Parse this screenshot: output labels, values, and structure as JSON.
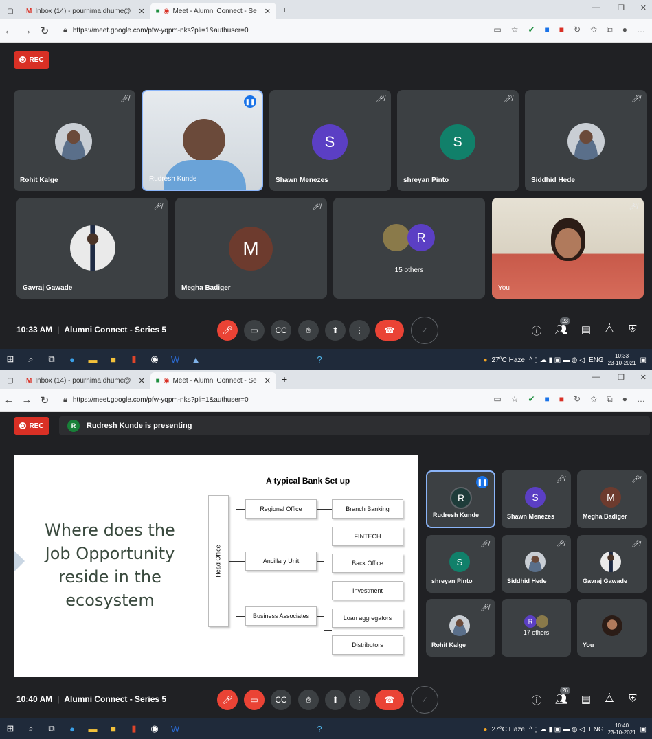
{
  "browser": {
    "tabs": [
      {
        "label": "Inbox (14) - pournima.dhume@",
        "icon": "gmail-icon"
      },
      {
        "label": "Meet - Alumni Connect - Se",
        "icon": "meet-icon"
      }
    ],
    "new_tab": "+",
    "url": "https://meet.google.com/pfw-yqpm-nks?pli=1&authuser=0"
  },
  "rec_label": "REC",
  "meeting_title": "Alumni Connect - Series 5",
  "screen1": {
    "time": "10:33 AM",
    "participants_badge": "23",
    "participants": [
      {
        "name": "Rohit Kalge"
      },
      {
        "name": "Rudresh Kunde"
      },
      {
        "name": "Shawn Menezes",
        "initial": "S",
        "color": "#5b3fc4"
      },
      {
        "name": "shreyan Pinto",
        "initial": "S",
        "color": "#11806a"
      },
      {
        "name": "Siddhid Hede"
      },
      {
        "name": "Gavraj Gawade"
      },
      {
        "name": "Megha Badiger",
        "initial": "M",
        "color": "#6d3b2e"
      },
      {
        "name": "15 others",
        "initial": "R",
        "color": "#5b3fc4"
      },
      {
        "name": "You"
      }
    ],
    "taskbar": {
      "temp": "27°C Haze",
      "lang": "ENG",
      "time": "10:33",
      "date": "23-10-2021"
    }
  },
  "screen2": {
    "time": "10:40 AM",
    "participants_badge": "26",
    "presenting_initial": "R",
    "presenting_text": "Rudresh Kunde is presenting",
    "slide": {
      "question": "Where does the Job Opportunity reside in the ecosystem",
      "title": "A typical Bank Set up",
      "head": "Head Office",
      "level1": [
        "Regional Office",
        "Ancillary Unit",
        "Business Associates"
      ],
      "level2": [
        "Branch Banking",
        "FINTECH",
        "Back Office",
        "Investment",
        "Loan aggregators",
        "Distributors"
      ]
    },
    "participants": [
      {
        "name": "Rudresh Kunde",
        "initial": "R",
        "color": "#1e3c3a"
      },
      {
        "name": "Shawn Menezes",
        "initial": "S",
        "color": "#5b3fc4"
      },
      {
        "name": "Megha Badiger",
        "initial": "M",
        "color": "#6d3b2e"
      },
      {
        "name": "shreyan Pinto",
        "initial": "S",
        "color": "#11806a"
      },
      {
        "name": "Siddhid Hede"
      },
      {
        "name": "Gavraj Gawade"
      },
      {
        "name": "Rohit Kalge"
      },
      {
        "name": "17 others",
        "initial": "R",
        "color": "#5b3fc4"
      },
      {
        "name": "You"
      }
    ],
    "taskbar": {
      "temp": "27°C Haze",
      "lang": "ENG",
      "time": "10:40",
      "date": "23-10-2021"
    }
  }
}
